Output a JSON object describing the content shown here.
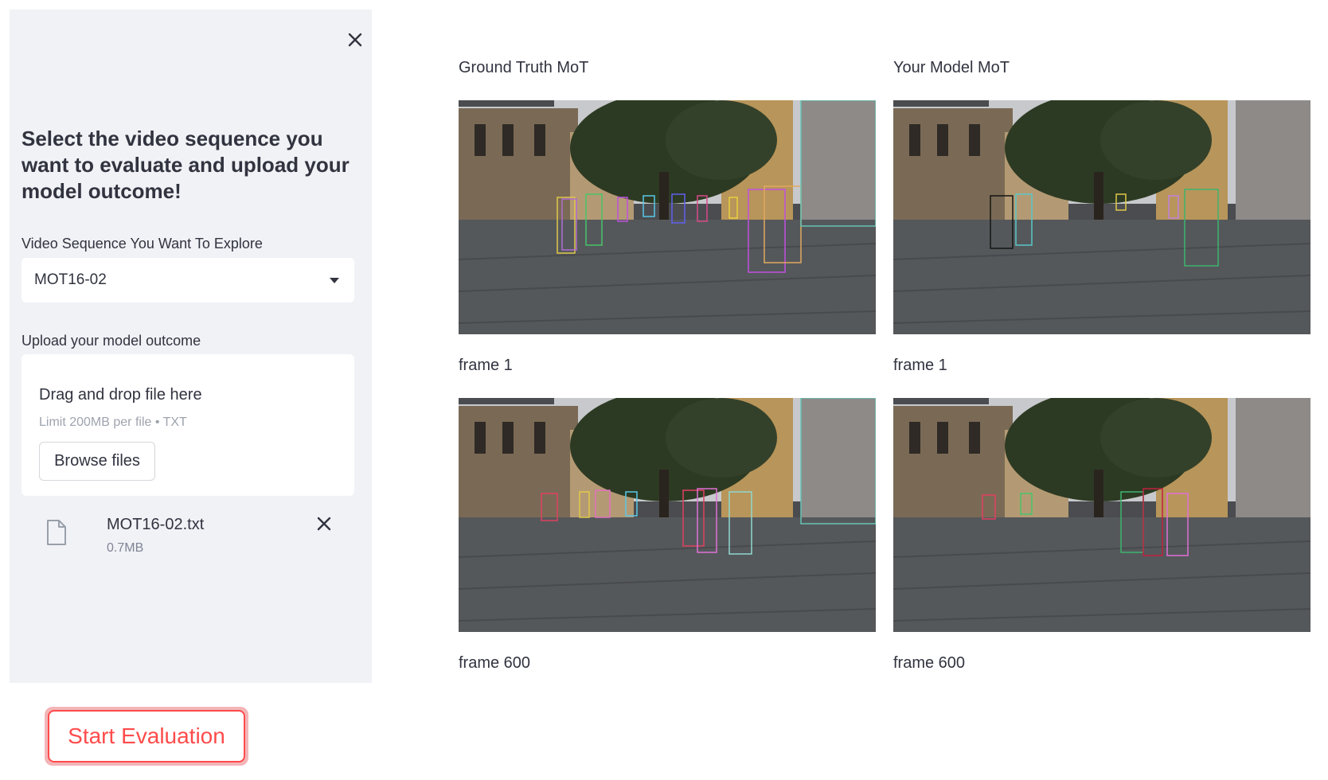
{
  "sidebar": {
    "heading": "Select the video sequence you want to evaluate and upload your model outcome!",
    "select_label": "Video Sequence You Want To Explore",
    "selected_sequence": "MOT16-02",
    "upload_label": "Upload your model outcome",
    "dropzone_title": "Drag and drop file here",
    "dropzone_limit": "Limit 200MB per file • TXT",
    "browse_label": "Browse files",
    "uploaded_file": {
      "name": "MOT16-02.txt",
      "size": "0.7MB"
    }
  },
  "actions": {
    "start_label": "Start Evaluation"
  },
  "columns": {
    "ground_truth_title": "Ground Truth MoT",
    "model_title": "Your Model MoT"
  },
  "frames": {
    "gt_top": "frame 1",
    "model_top": "frame 1",
    "gt_bottom": "frame 600",
    "model_bottom": "frame 600"
  },
  "colors": {
    "accent": "#ff4b4b",
    "sidebar_bg": "#f0f2f6",
    "text": "#31333f"
  },
  "icons": {
    "close": "close-icon",
    "caret": "chevron-down-icon",
    "file": "file-icon",
    "remove": "close-icon"
  }
}
